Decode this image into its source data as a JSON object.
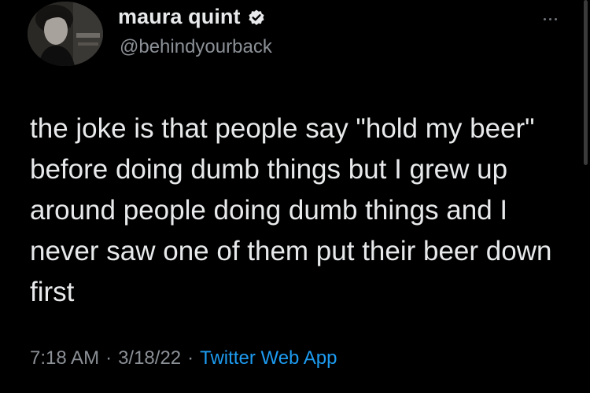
{
  "tweet": {
    "author": {
      "display_name": "maura quint",
      "handle": "@behindyourback",
      "verified": true
    },
    "text": "the joke is that people say \"hold my beer\" before doing dumb things but I grew up around people doing dumb things and I never saw one of them put their beer down first",
    "time": "7:18 AM",
    "date": "3/18/22",
    "separator": "·",
    "source": "Twitter Web App"
  },
  "icons": {
    "verified": "verified-badge-icon",
    "more": "more-options-icon"
  },
  "colors": {
    "background": "#000000",
    "text": "#e7e9ea",
    "secondary": "#8b9096",
    "link": "#1d9bf0"
  }
}
